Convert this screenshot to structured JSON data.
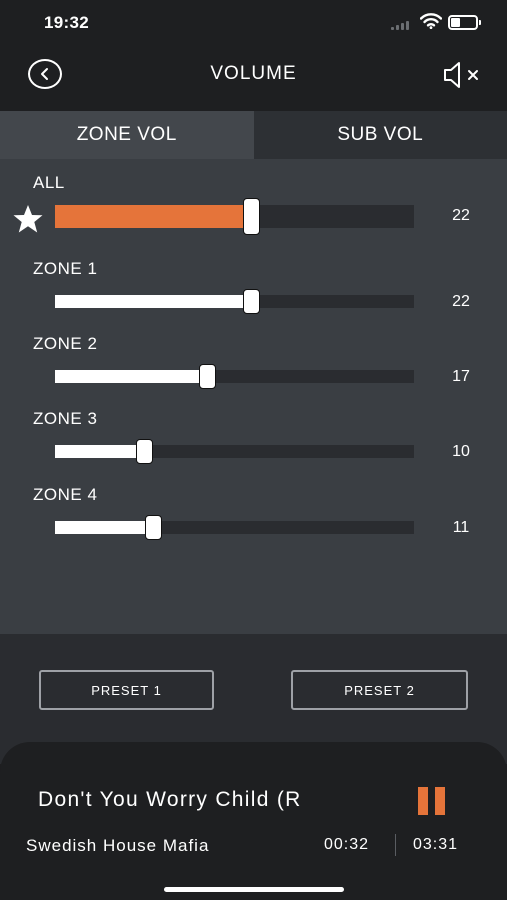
{
  "status": {
    "time": "19:32"
  },
  "header": {
    "title": "VOLUME"
  },
  "tabs": [
    {
      "label": "ZONE VOL",
      "active": true
    },
    {
      "label": "SUB VOL",
      "active": false
    }
  ],
  "zones": [
    {
      "label": "ALL",
      "value": "22",
      "level": 0.55,
      "favorite": true
    },
    {
      "label": "ZONE 1",
      "value": "22",
      "level": 0.55
    },
    {
      "label": "ZONE 2",
      "value": "17",
      "level": 0.425
    },
    {
      "label": "ZONE 3",
      "value": "10",
      "level": 0.25
    },
    {
      "label": "ZONE 4",
      "value": "11",
      "level": 0.275
    }
  ],
  "presets": [
    {
      "label": "PRESET 1"
    },
    {
      "label": "PRESET 2"
    }
  ],
  "now_playing": {
    "title": "Don't You Worry Child (R",
    "artist": "Swedish House Mafia",
    "elapsed": "00:32",
    "total": "03:31"
  },
  "colors": {
    "accent": "#e5743a",
    "panel": "#3a3e43",
    "dark": "#1e1f21"
  }
}
